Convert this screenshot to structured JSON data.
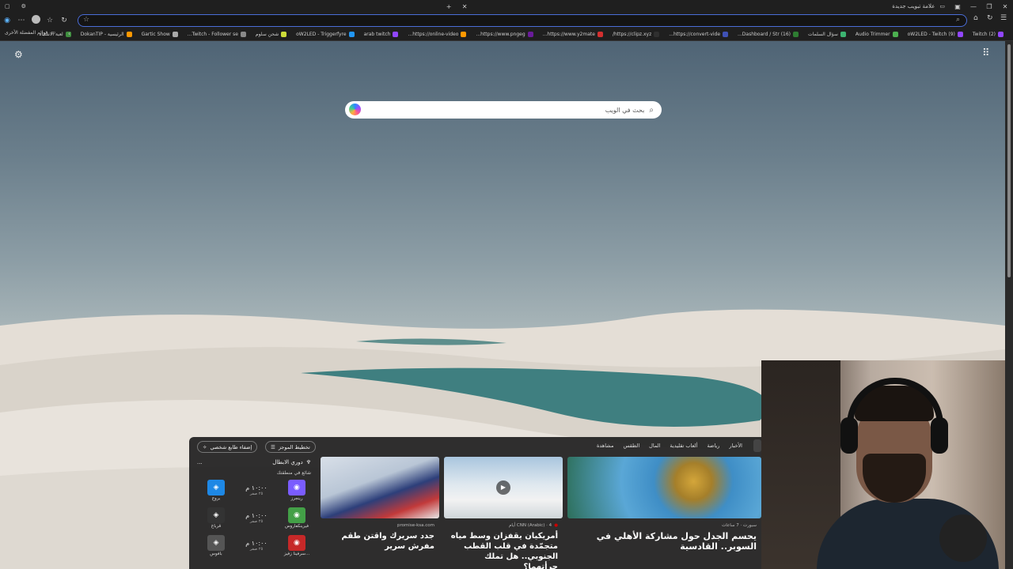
{
  "window": {
    "tab_title": "علامة تبويب جديدة",
    "controls": [
      "minimize",
      "restore",
      "close"
    ]
  },
  "toolbar": {
    "address_value": ""
  },
  "bookmarks": [
    "(2) Twitch",
    "(9) oW2LED - Twitch",
    "Audio Trimmer",
    "سؤال السلمات",
    "(16) Dashboard / Str...",
    "https://convert-vide...",
    "https://clipz.xyz/",
    "https://www.y2mate...",
    "https://www.pngeg...",
    "https://online-video...",
    "arab twitch",
    "oW2LED - Triggerfyre",
    "شحن سلوم",
    "Twitch - Follower se...",
    "Gartic Show",
    "الرئيسية - DokanTIP",
    "لعبة الاشتباه"
  ],
  "bookmarks_folder": "قوائم المفضلة الأخرى",
  "search": {
    "placeholder": "بحث في الويب"
  },
  "feed": {
    "personalize_label": "إضفاء طابع شخصي",
    "layout_label": "تخطيط الموجز",
    "nav": [
      "الأخبار",
      "رياضة",
      "ألعاب تقليدية",
      "المال",
      "الطقس",
      "مشاهدة"
    ],
    "sports": {
      "league": "دوري الابطال",
      "subtitle": "شائع في منطقتك",
      "more": "...",
      "matches": [
        {
          "home": "رينجرز",
          "away": "بروج",
          "time": "١٠:٠٠ م",
          "date": "٢٥ صفر"
        },
        {
          "home": "فيرينكفاروس",
          "away": "قرباغ",
          "time": "١٠:٠٠ م",
          "date": "٢٥ صفر"
        },
        {
          "home": "سرفينا زفيز...",
          "away": "بافوس",
          "time": "١٠:٠٠ م",
          "date": "٢٥ صفر"
        }
      ]
    },
    "cards": [
      {
        "source": "promise-ksa.com",
        "title": "جدد سريرك واقتن طقم مفرش سرير"
      },
      {
        "source": "CNN (Arabic) · 4 أيام",
        "title": "أمريكيان يقفزان وسط مياه متجمّدة في قلب القطب الجنوبي.. هل تملك جرأتهما؟"
      },
      {
        "source": "سبورت · 7 ساعات",
        "title": "يحسم الجدل حول مشاركة الأهلي في السوبر.. القادسية"
      }
    ]
  }
}
